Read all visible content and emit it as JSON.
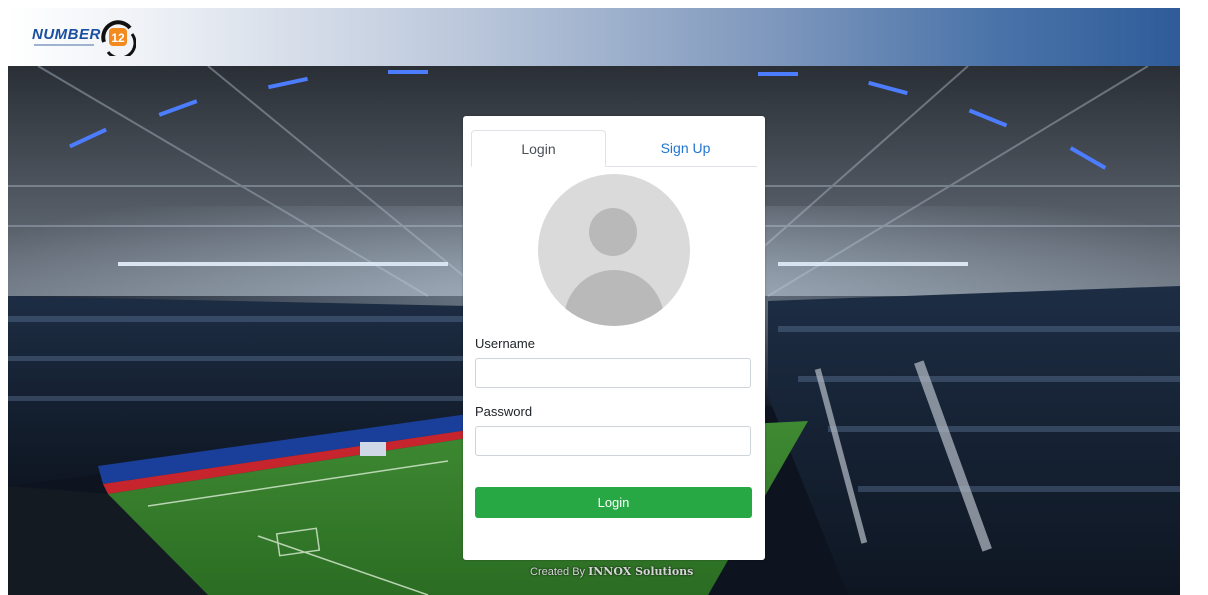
{
  "header": {
    "logo_text": "NUMBER",
    "logo_number": "12"
  },
  "login_card": {
    "tabs": [
      {
        "label": "Login",
        "active": true
      },
      {
        "label": "Sign Up",
        "active": false
      }
    ],
    "username_label": "Username",
    "username_value": "",
    "password_label": "Password",
    "password_value": "",
    "login_button": "Login"
  },
  "footer": {
    "created_by_prefix": "Created By",
    "company": "INNOX Solutions"
  },
  "colors": {
    "accent_green": "#28a745",
    "tab_link_blue": "#1f76d1",
    "header_blue": "#2f5c99"
  }
}
